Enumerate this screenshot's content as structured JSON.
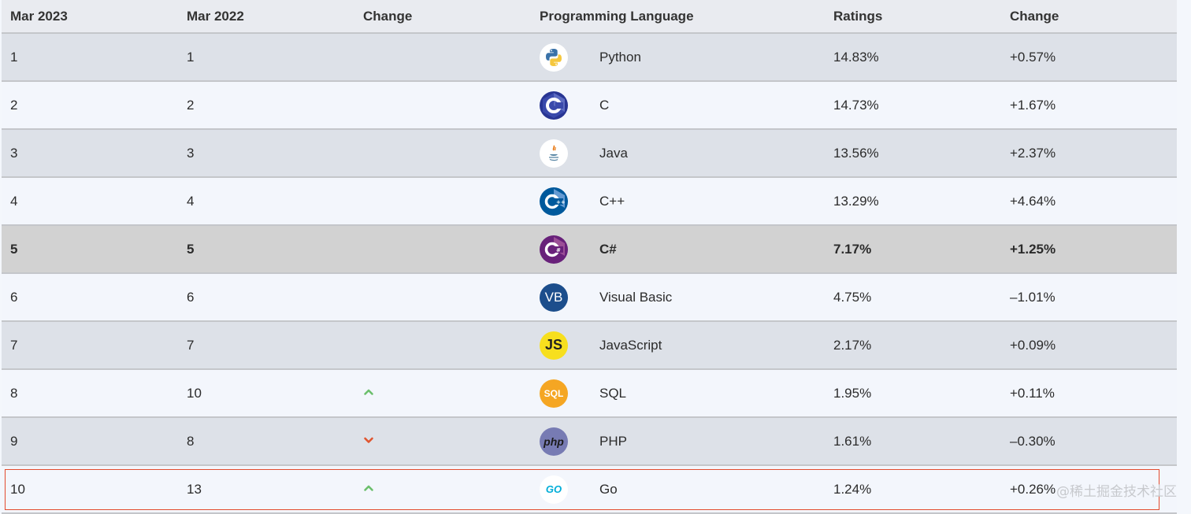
{
  "table": {
    "headers": {
      "mar2023": "Mar 2023",
      "mar2022": "Mar 2022",
      "change": "Change",
      "language": "Programming Language",
      "ratings": "Ratings",
      "change2": "Change"
    },
    "rows": [
      {
        "rank_2023": "1",
        "rank_2022": "1",
        "trend": "",
        "logo": "python-icon",
        "language": "Python",
        "rating": "14.83%",
        "change": "+0.57%"
      },
      {
        "rank_2023": "2",
        "rank_2022": "2",
        "trend": "",
        "logo": "c-icon",
        "language": "C",
        "rating": "14.73%",
        "change": "+1.67%"
      },
      {
        "rank_2023": "3",
        "rank_2022": "3",
        "trend": "",
        "logo": "java-icon",
        "language": "Java",
        "rating": "13.56%",
        "change": "+2.37%"
      },
      {
        "rank_2023": "4",
        "rank_2022": "4",
        "trend": "",
        "logo": "cpp-icon",
        "language": "C++",
        "rating": "13.29%",
        "change": "+4.64%"
      },
      {
        "rank_2023": "5",
        "rank_2022": "5",
        "trend": "",
        "logo": "csharp-icon",
        "language": "C#",
        "rating": "7.17%",
        "change": "+1.25%"
      },
      {
        "rank_2023": "6",
        "rank_2022": "6",
        "trend": "",
        "logo": "vb-icon",
        "language": "Visual Basic",
        "rating": "4.75%",
        "change": "–1.01%"
      },
      {
        "rank_2023": "7",
        "rank_2022": "7",
        "trend": "",
        "logo": "js-icon",
        "language": "JavaScript",
        "rating": "2.17%",
        "change": "+0.09%"
      },
      {
        "rank_2023": "8",
        "rank_2022": "10",
        "trend": "up",
        "logo": "sql-icon",
        "language": "SQL",
        "rating": "1.95%",
        "change": "+0.11%"
      },
      {
        "rank_2023": "9",
        "rank_2022": "8",
        "trend": "down",
        "logo": "php-icon",
        "language": "PHP",
        "rating": "1.61%",
        "change": "–0.30%"
      },
      {
        "rank_2023": "10",
        "rank_2022": "13",
        "trend": "up",
        "logo": "go-icon",
        "language": "Go",
        "rating": "1.24%",
        "change": "+0.26%"
      }
    ],
    "logo_text": {
      "vb": "VB",
      "js": "JS",
      "sql": "SQL",
      "php": "php",
      "go": "GO"
    }
  },
  "watermark": "@稀土掘金技术社区",
  "colors": {
    "highlight_border": "#e34b2e",
    "trend_up": "#6cbf6c",
    "trend_down": "#e0552f"
  }
}
